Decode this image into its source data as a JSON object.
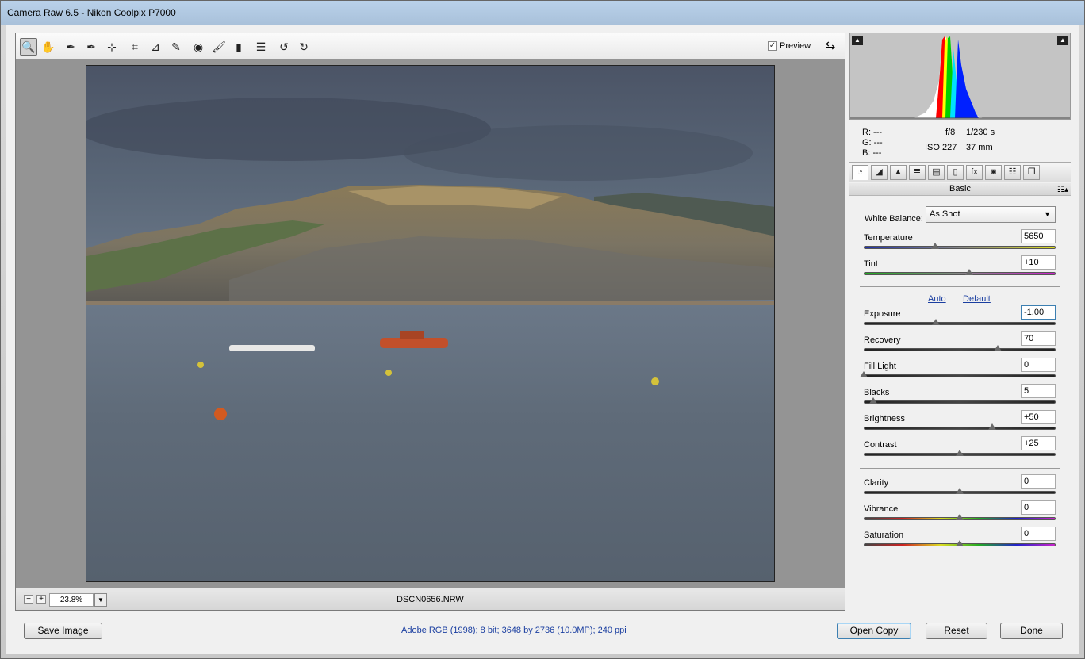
{
  "window": {
    "title": "Camera Raw 6.5  -  Nikon Coolpix P7000"
  },
  "toolbar": {
    "tools": [
      {
        "icon": "zoom-icon",
        "glyph": "🔍"
      },
      {
        "icon": "hand-icon",
        "glyph": "✋"
      },
      {
        "icon": "white-balance-icon",
        "glyph": "✒"
      },
      {
        "icon": "color-sampler-icon",
        "glyph": "✒"
      },
      {
        "icon": "targeted-adjustment-icon",
        "glyph": "⊹"
      },
      {
        "icon": "crop-icon",
        "glyph": "⌗"
      },
      {
        "icon": "straighten-icon",
        "glyph": "⊿"
      },
      {
        "icon": "spot-removal-icon",
        "glyph": "✎"
      },
      {
        "icon": "red-eye-icon",
        "glyph": "◉"
      },
      {
        "icon": "adjustment-brush-icon",
        "glyph": "🖌"
      },
      {
        "icon": "graduated-filter-icon",
        "glyph": "▮"
      },
      {
        "icon": "preferences-icon",
        "glyph": "☰"
      },
      {
        "icon": "rotate-left-icon",
        "glyph": "↺"
      },
      {
        "icon": "rotate-right-icon",
        "glyph": "↻"
      }
    ],
    "preview_label": "Preview",
    "preview_checked": true
  },
  "status": {
    "zoom": "23.8%",
    "filename": "DSCN0656.NRW"
  },
  "info": {
    "r": "R:  ---",
    "g": "G:  ---",
    "b": "B:  ---",
    "aperture": "f/8",
    "shutter": "1/230 s",
    "iso": "ISO 227",
    "focal": "37 mm"
  },
  "tabs": [
    {
      "icon": "basic-tab-icon",
      "glyph": "◔"
    },
    {
      "icon": "tone-curve-tab-icon",
      "glyph": "◢"
    },
    {
      "icon": "detail-tab-icon",
      "glyph": "▲"
    },
    {
      "icon": "hsl-tab-icon",
      "glyph": "≣"
    },
    {
      "icon": "split-toning-tab-icon",
      "glyph": "▤"
    },
    {
      "icon": "lens-corrections-tab-icon",
      "glyph": "▯"
    },
    {
      "icon": "effects-tab-icon",
      "glyph": "fx"
    },
    {
      "icon": "camera-calibration-tab-icon",
      "glyph": "◙"
    },
    {
      "icon": "presets-tab-icon",
      "glyph": "☷"
    },
    {
      "icon": "snapshots-tab-icon",
      "glyph": "❐"
    }
  ],
  "panel": {
    "title": "Basic",
    "white_balance_label": "White Balance:",
    "white_balance_value": "As Shot",
    "auto_label": "Auto",
    "default_label": "Default"
  },
  "sliders": [
    {
      "label": "Temperature",
      "value": "5650",
      "pos": 0.37,
      "track": "temp"
    },
    {
      "label": "Tint",
      "value": "+10",
      "pos": 0.55,
      "track": "tint"
    },
    {
      "label": "Exposure",
      "value": "-1.00",
      "pos": 0.375,
      "track": "gray",
      "focus": true
    },
    {
      "label": "Recovery",
      "value": "70",
      "pos": 0.7,
      "track": "gray"
    },
    {
      "label": "Fill Light",
      "value": "0",
      "pos": 0.0,
      "track": "gray"
    },
    {
      "label": "Blacks",
      "value": "5",
      "pos": 0.05,
      "track": "gray"
    },
    {
      "label": "Brightness",
      "value": "+50",
      "pos": 0.67,
      "track": "gray"
    },
    {
      "label": "Contrast",
      "value": "+25",
      "pos": 0.5,
      "track": "gray"
    },
    {
      "label": "Clarity",
      "value": "0",
      "pos": 0.5,
      "track": "gray"
    },
    {
      "label": "Vibrance",
      "value": "0",
      "pos": 0.5,
      "track": "rainbow"
    },
    {
      "label": "Saturation",
      "value": "0",
      "pos": 0.5,
      "track": "rainbow"
    }
  ],
  "bottom": {
    "save_label": "Save Image",
    "workflow_options": "Adobe RGB (1998); 8 bit; 3648 by 2736 (10.0MP); 240 ppi",
    "open_label": "Open Copy",
    "reset_label": "Reset",
    "done_label": "Done"
  }
}
